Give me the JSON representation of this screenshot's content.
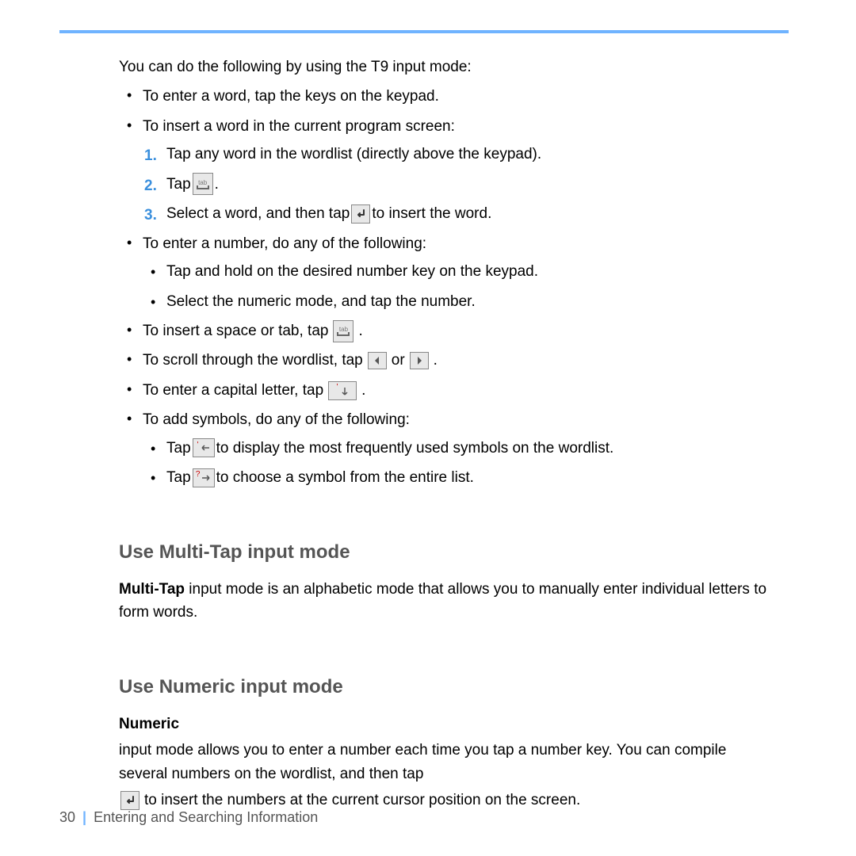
{
  "intro": "You can do the following by using the T9 input mode:",
  "bullets": {
    "b1": "To enter a word, tap the keys on the keypad.",
    "b2": "To insert a word in the current program screen:",
    "b2_steps": {
      "s1": "Tap any word in the wordlist (directly above the keypad).",
      "s2_pre": "Tap",
      "s2_post": ".",
      "s3_pre": "Select a word, and then tap",
      "s3_post": "to insert the word."
    },
    "b3": "To enter a number, do any of the following:",
    "b3_subs": {
      "a": "Tap and hold on the desired number key on the keypad.",
      "b": "Select the numeric mode, and tap the number."
    },
    "b4_pre": "To insert a space or tab, tap",
    "b4_post": ".",
    "b5_pre": "To scroll through the wordlist, tap",
    "b5_mid": "or",
    "b5_post": ".",
    "b6_pre": "To enter a capital letter, tap",
    "b6_post": ".",
    "b7": "To add symbols, do any of the following:",
    "b7_subs": {
      "a_pre": "Tap",
      "a_post": "to display the most frequently used symbols on the wordlist.",
      "b_pre": "Tap",
      "b_post": "to choose a symbol from the entire list."
    }
  },
  "nums": {
    "n1": "1.",
    "n2": "2.",
    "n3": "3."
  },
  "section1": {
    "heading": "Use Multi-Tap input mode",
    "bold": "Multi-Tap",
    "rest": " input mode is an alphabetic mode that allows you to manually enter individual letters to form words."
  },
  "section2": {
    "heading": "Use Numeric input mode",
    "bold": "Numeric",
    "part1": " input mode allows you to enter a number each time you tap a number key. You can compile several numbers on the wordlist, and then tap ",
    "part2": " to insert the numbers at the current cursor position on the screen."
  },
  "footer": {
    "page": "30",
    "chapter": "Entering and Searching Information"
  },
  "icons": {
    "tab_label": "tab"
  }
}
